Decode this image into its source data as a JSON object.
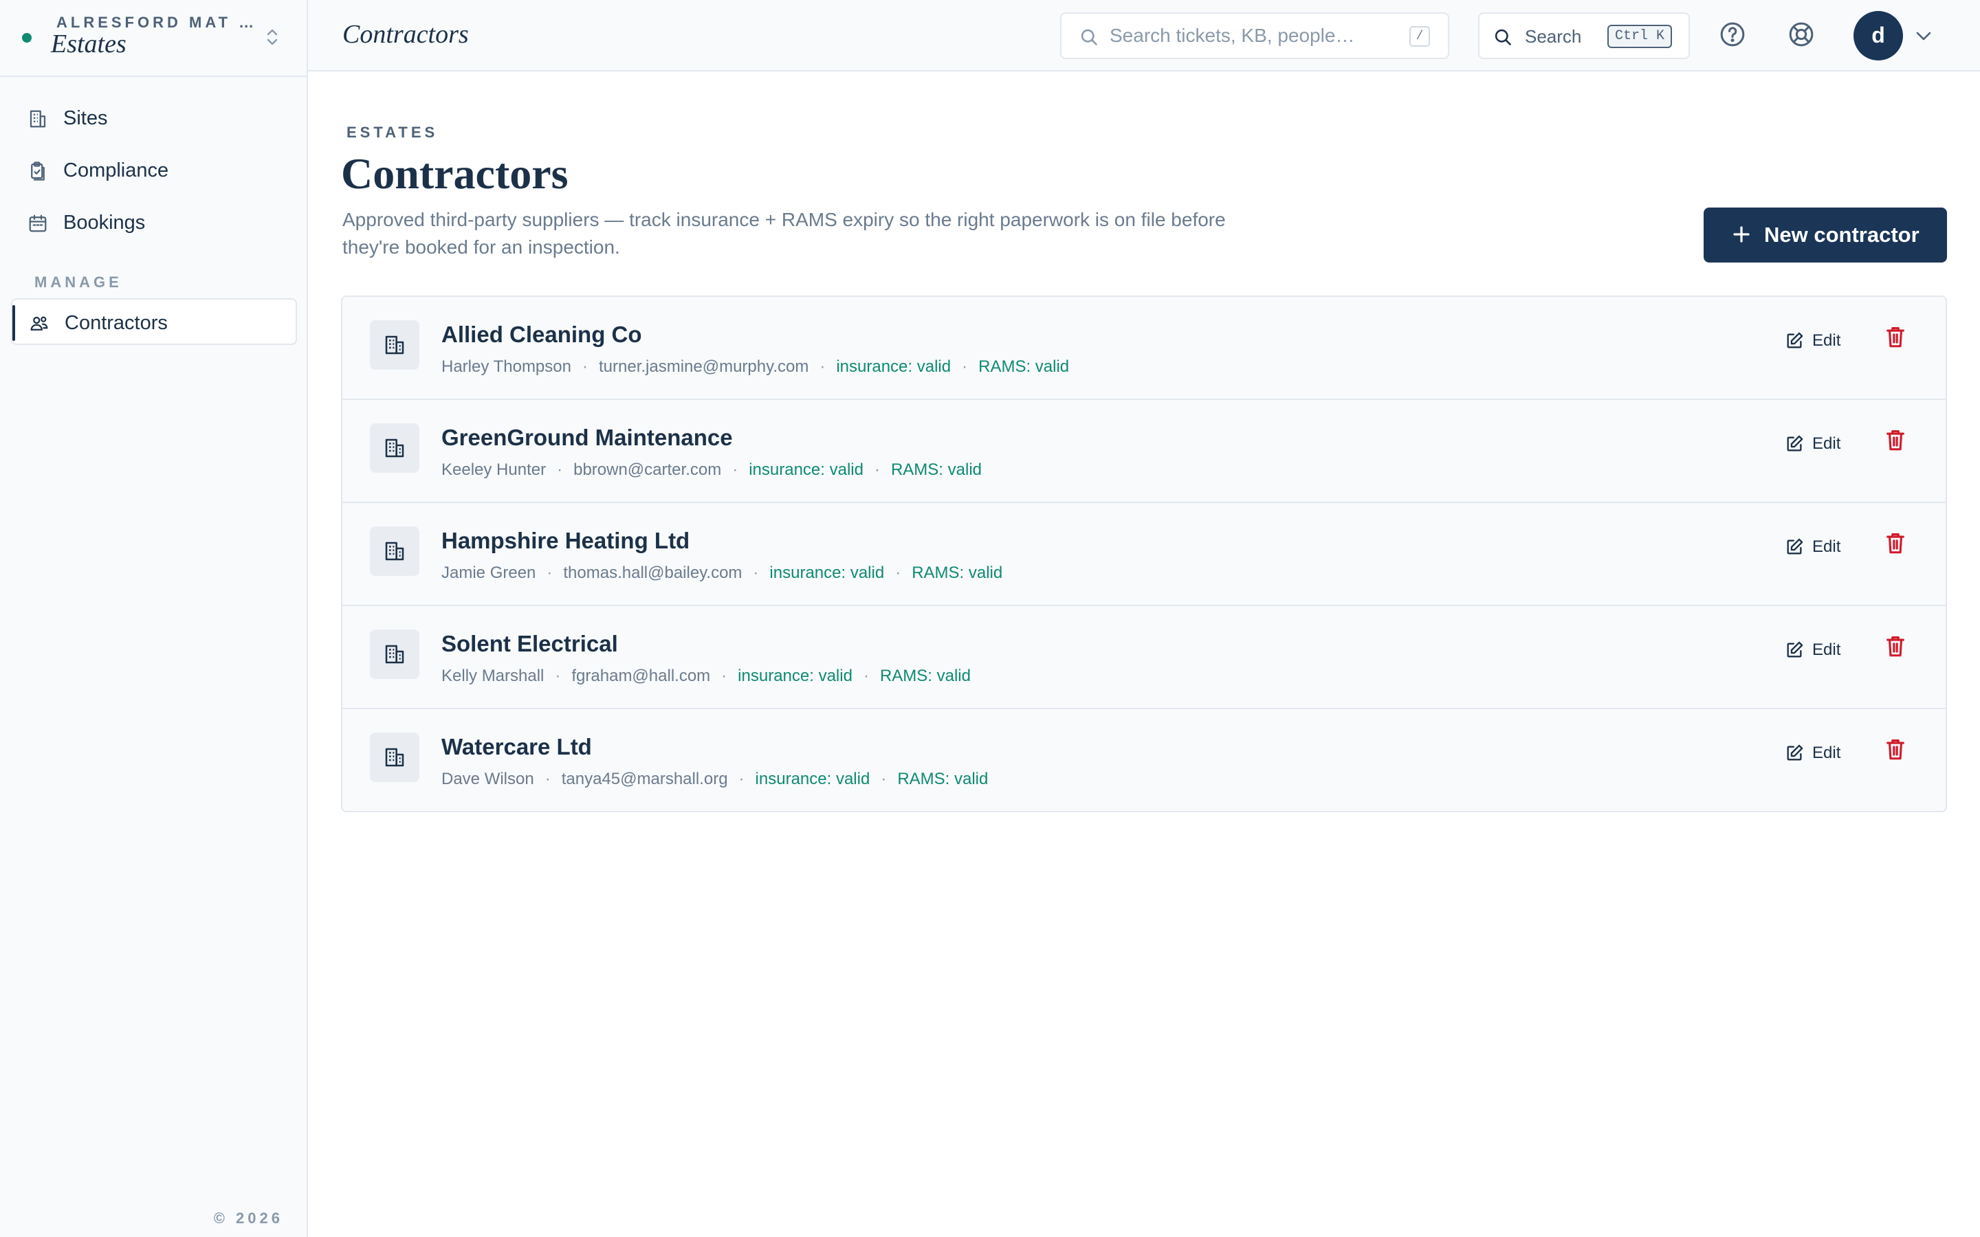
{
  "org": {
    "name": "ALRESFORD MAT …",
    "title": "Estates"
  },
  "sidebar": {
    "items": [
      {
        "label": "Sites",
        "icon": "building-icon"
      },
      {
        "label": "Compliance",
        "icon": "clipboard-check-icon"
      },
      {
        "label": "Bookings",
        "icon": "calendar-icon"
      }
    ],
    "section_label": "MANAGE",
    "manage_items": [
      {
        "label": "Contractors",
        "icon": "users-icon",
        "active": true
      }
    ],
    "copyright": "© 2026"
  },
  "header": {
    "title": "Contractors",
    "search_placeholder": "Search tickets, KB, people…",
    "search_shortcut": "/",
    "command_search_label": "Search",
    "command_shortcut": "Ctrl K",
    "avatar_initial": "d"
  },
  "page": {
    "eyebrow": "ESTATES",
    "title": "Contractors",
    "description": "Approved third-party suppliers — track insurance + RAMS expiry so the right paperwork is on file before they're booked for an inspection.",
    "new_button_label": "New contractor"
  },
  "contractors": [
    {
      "name": "Allied Cleaning Co",
      "contact": "Harley Thompson",
      "email": "turner.jasmine@murphy.com",
      "insurance": "insurance: valid",
      "rams": "RAMS: valid"
    },
    {
      "name": "GreenGround Maintenance",
      "contact": "Keeley Hunter",
      "email": "bbrown@carter.com",
      "insurance": "insurance: valid",
      "rams": "RAMS: valid"
    },
    {
      "name": "Hampshire Heating Ltd",
      "contact": "Jamie Green",
      "email": "thomas.hall@bailey.com",
      "insurance": "insurance: valid",
      "rams": "RAMS: valid"
    },
    {
      "name": "Solent Electrical",
      "contact": "Kelly Marshall",
      "email": "fgraham@hall.com",
      "insurance": "insurance: valid",
      "rams": "RAMS: valid"
    },
    {
      "name": "Watercare Ltd",
      "contact": "Dave Wilson",
      "email": "tanya45@marshall.org",
      "insurance": "insurance: valid",
      "rams": "RAMS: valid"
    }
  ],
  "row_actions": {
    "edit_label": "Edit"
  },
  "colors": {
    "primary": "#1a3556",
    "valid": "#0f8a73",
    "danger": "#d11a2a",
    "muted": "#6a7b8e"
  }
}
